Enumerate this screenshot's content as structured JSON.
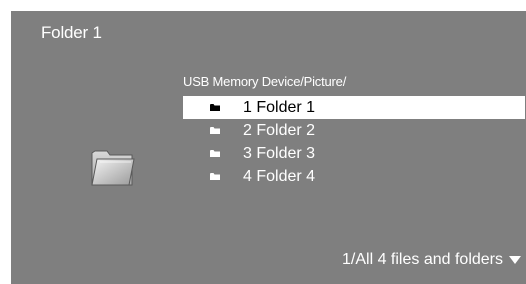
{
  "header": {
    "title": "Folder 1"
  },
  "browser": {
    "path": "USB Memory Device/Picture/",
    "items": [
      {
        "label": "1 Folder 1",
        "icon": "folder-icon",
        "selected": true
      },
      {
        "label": "2 Folder 2",
        "icon": "folder-icon",
        "selected": false
      },
      {
        "label": "3 Folder 3",
        "icon": "folder-icon",
        "selected": false
      },
      {
        "label": "4 Folder 4",
        "icon": "folder-icon",
        "selected": false
      }
    ]
  },
  "preview": {
    "icon": "open-folder-icon"
  },
  "footer": {
    "status": "1/All 4 files and folders",
    "icon": "caret-down-icon"
  },
  "colors": {
    "background": "#7f7f7f",
    "text": "#ffffff",
    "selection_background": "#ffffff",
    "selection_text": "#000000"
  }
}
